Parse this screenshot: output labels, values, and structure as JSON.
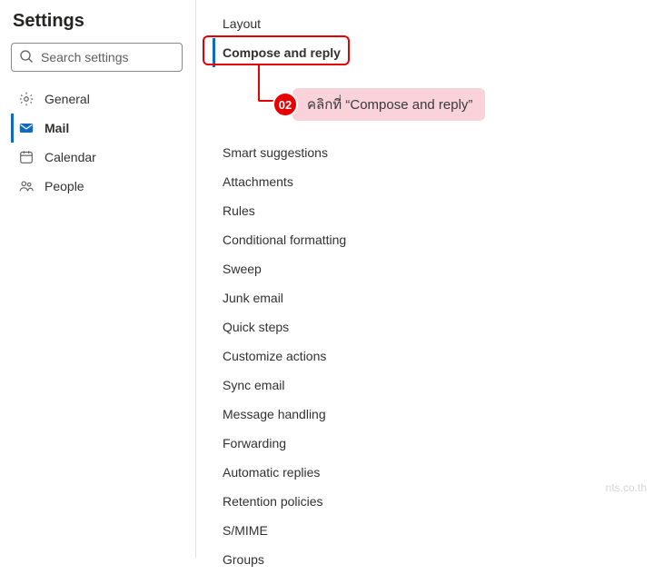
{
  "title": "Settings",
  "search": {
    "placeholder": "Search settings"
  },
  "nav": {
    "general": "General",
    "mail": "Mail",
    "calendar": "Calendar",
    "people": "People"
  },
  "sub": {
    "layout": "Layout",
    "compose": "Compose and reply",
    "smart": "Smart suggestions",
    "attachments": "Attachments",
    "rules": "Rules",
    "conditional": "Conditional formatting",
    "sweep": "Sweep",
    "junk": "Junk email",
    "quicksteps": "Quick steps",
    "customize": "Customize actions",
    "sync": "Sync email",
    "message": "Message handling",
    "forwarding": "Forwarding",
    "autoreplies": "Automatic replies",
    "retention": "Retention policies",
    "smime": "S/MIME",
    "groups": "Groups"
  },
  "callout": {
    "number": "02",
    "text": "คลิกที่ “Compose and reply”"
  },
  "watermark": "nts.co.th"
}
